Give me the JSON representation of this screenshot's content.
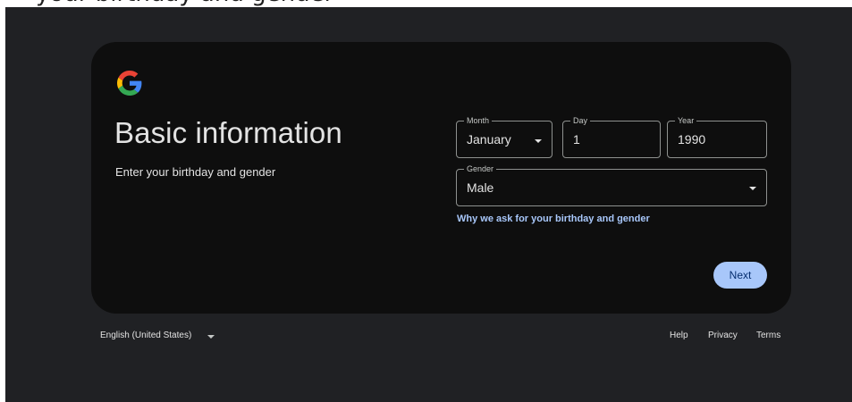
{
  "colors": {
    "page_bg": "#202124",
    "card_bg": "#0e0e0e",
    "accent": "#a8c7fa",
    "text": "#e3e3e3"
  },
  "top_heading_fragment": "your birthday and gender",
  "logo": {
    "icon": "google-g-icon"
  },
  "header": {
    "title": "Basic information",
    "subtitle": "Enter your birthday and gender"
  },
  "form": {
    "month": {
      "label": "Month",
      "value": "January"
    },
    "day": {
      "label": "Day",
      "value": "1"
    },
    "year": {
      "label": "Year",
      "value": "1990"
    },
    "gender": {
      "label": "Gender",
      "value": "Male"
    },
    "why_link": "Why we ask for your birthday and gender",
    "next_label": "Next"
  },
  "footer": {
    "language": "English (United States)",
    "links": {
      "help": "Help",
      "privacy": "Privacy",
      "terms": "Terms"
    }
  }
}
